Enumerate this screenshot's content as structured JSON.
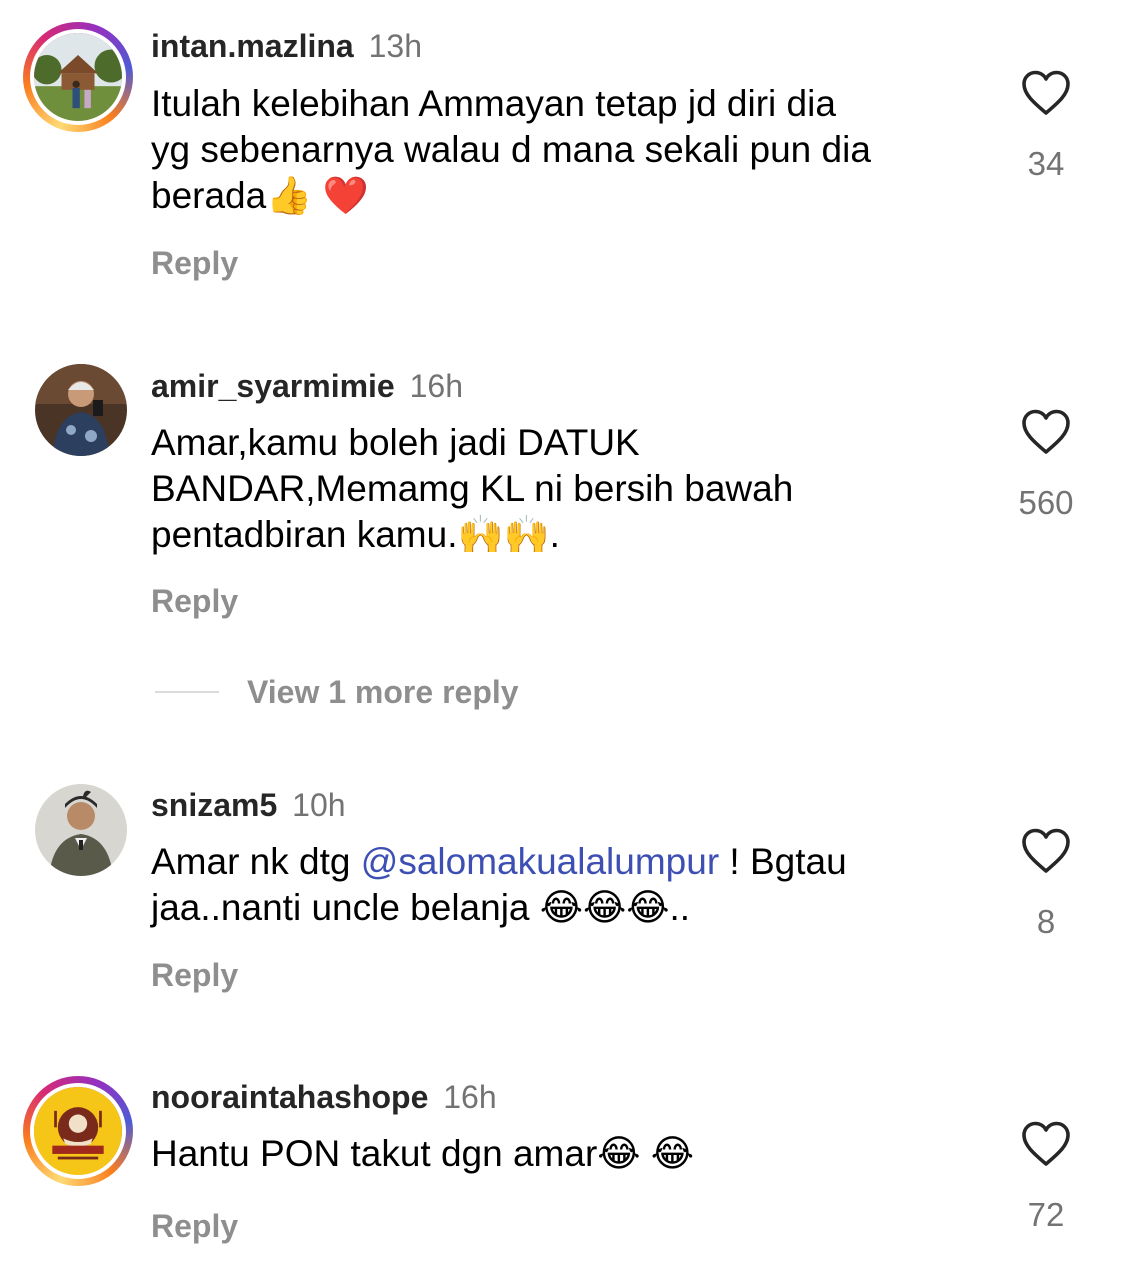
{
  "comments": [
    {
      "username": "intan.mazlina",
      "time": "13h",
      "text_lines": [
        "Itulah kelebihan Ammayan tetap jd diri dia",
        "yg sebenarnya walau d mana sekali pun dia",
        "berada👍 ❤️"
      ],
      "likes": "34",
      "reply_label": "Reply",
      "avatar_icon": "photo-avatar-house"
    },
    {
      "username": "amir_syarmimie",
      "time": "16h",
      "text_lines": [
        "Amar,kamu boleh jadi DATUK",
        "BANDAR,Memamg KL ni bersih bawah",
        "pentadbiran kamu.🙌🙌."
      ],
      "likes": "560",
      "reply_label": "Reply",
      "avatar_icon": "photo-avatar-man"
    },
    {
      "username": "snizam5",
      "time": "10h",
      "text_before_mention": "Amar nk dtg ",
      "mention": "@salomakualalumpur",
      "text_after_mention": " ! Bgtau",
      "text_line2": "jaa..nanti uncle belanja 😂😂😂..",
      "likes": "8",
      "reply_label": "Reply",
      "avatar_icon": "photo-avatar-man-hat"
    },
    {
      "username": "nooraintahashope",
      "time": "16h",
      "text_lines": [
        "Hantu PON takut dgn amar😂 😂"
      ],
      "likes": "72",
      "reply_label": "Reply",
      "avatar_icon": "logo-avatar-yellow"
    }
  ],
  "view_more": "View 1 more reply",
  "colors": {
    "username": "#262626",
    "meta": "#737373",
    "reply": "#8e8e8e",
    "mention": "#3d4fb2"
  }
}
